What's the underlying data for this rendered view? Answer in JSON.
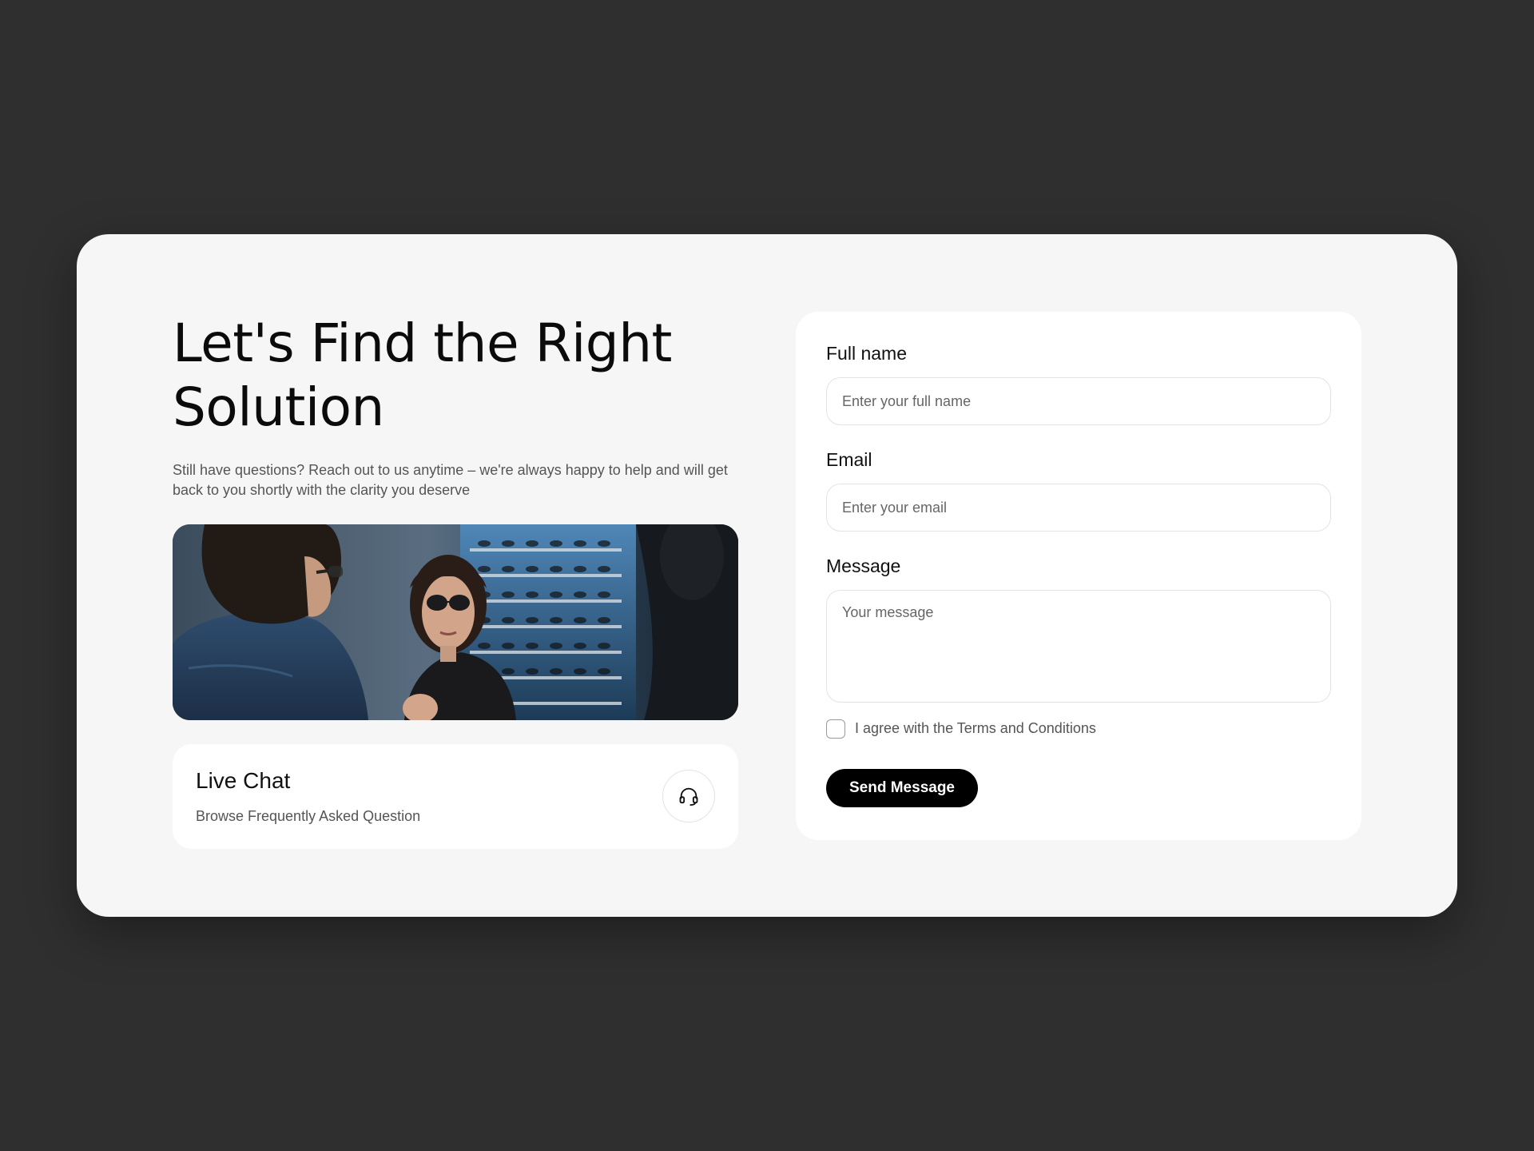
{
  "hero": {
    "headline_line1": "Let's Find the Right",
    "headline_line2": "Solution",
    "subtext": "Still have questions? Reach out to us anytime – we're always happy to help and will get back to you shortly with the clarity you deserve",
    "image_icon": "sunglasses-shop-photo"
  },
  "live_chat": {
    "title": "Live Chat",
    "subtitle": "Browse Frequently Asked Question",
    "icon": "headset-icon"
  },
  "form": {
    "full_name_label": "Full name",
    "full_name_placeholder": "Enter your full name",
    "full_name_value": "",
    "email_label": "Email",
    "email_placeholder": "Enter your email",
    "email_value": "",
    "message_label": "Message",
    "message_placeholder": "Your message",
    "message_value": "",
    "terms_label": "I agree with the Terms and Conditions",
    "terms_checked": false,
    "submit_label": "Send Message"
  },
  "colors": {
    "background": "#2f2f2f",
    "card": "#f6f6f6",
    "panel": "#ffffff",
    "accent": "#000000"
  }
}
